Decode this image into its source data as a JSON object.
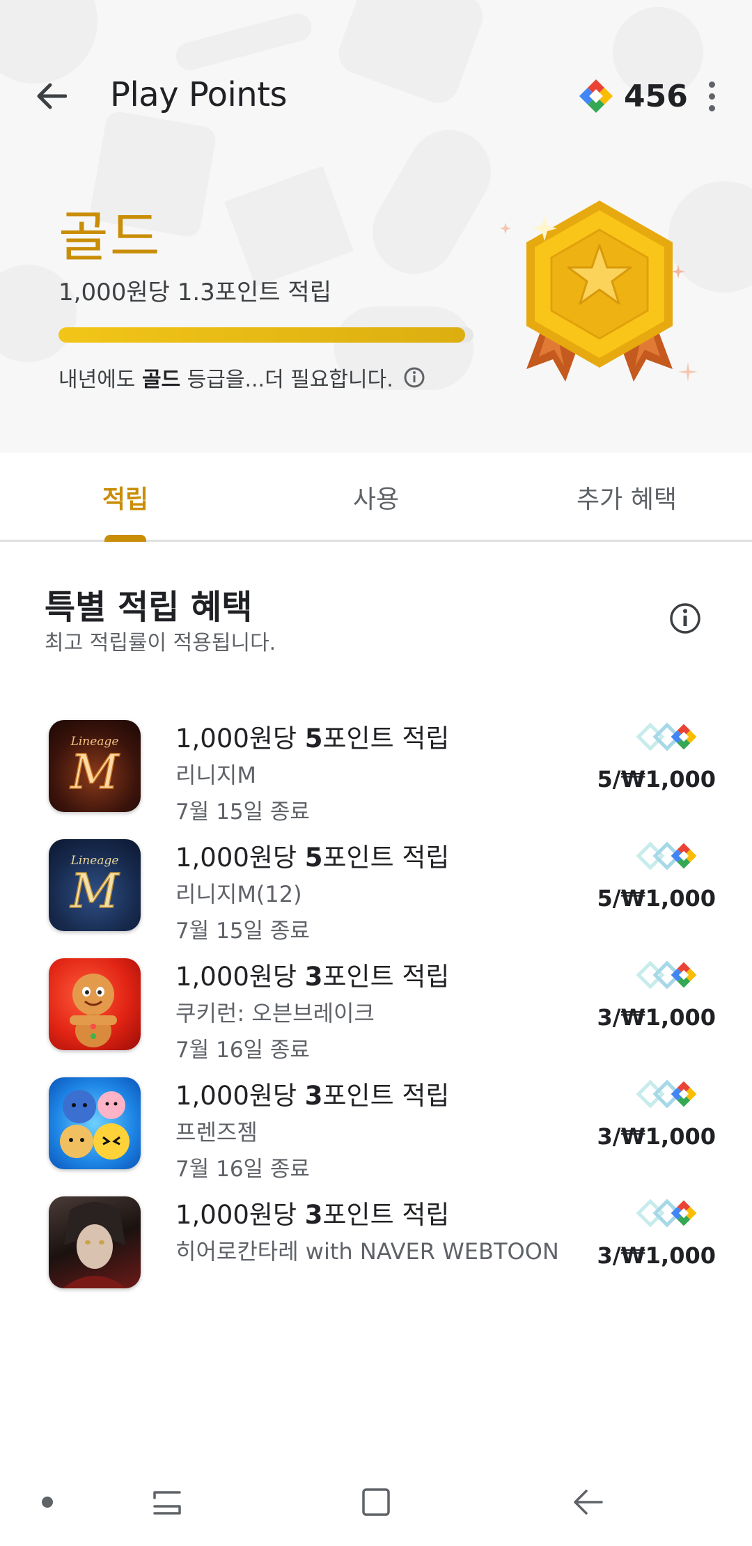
{
  "app_bar": {
    "title": "Play Points",
    "points": "456"
  },
  "tier": {
    "name": "골드",
    "rate_text": "1,000원당 1.3포인트 적립",
    "progress": 0.98,
    "note_prefix": "내년에도 ",
    "note_tier": "골드",
    "note_suffix": " 등급을...더 필요합니다."
  },
  "tabs": [
    {
      "label": "적립",
      "selected": true
    },
    {
      "label": "사용",
      "selected": false
    },
    {
      "label": "추가 혜택",
      "selected": false
    }
  ],
  "section": {
    "title": "특별 적립 혜택",
    "subtitle": "최고 적립률이 적용됩니다."
  },
  "offers": [
    {
      "title_prefix": "1,000원당 ",
      "title_bold": "5",
      "title_suffix": "포인트 적립",
      "app": "리니지M",
      "end": "7월 15일 종료",
      "rate": "5/₩1,000",
      "icon": "lineage-m-icon"
    },
    {
      "title_prefix": "1,000원당 ",
      "title_bold": "5",
      "title_suffix": "포인트 적립",
      "app": "리니지M(12)",
      "end": "7월 15일 종료",
      "rate": "5/₩1,000",
      "icon": "lineage-m-12-icon"
    },
    {
      "title_prefix": "1,000원당 ",
      "title_bold": "3",
      "title_suffix": "포인트 적립",
      "app": "쿠키런: 오븐브레이크",
      "end": "7월 16일 종료",
      "rate": "3/₩1,000",
      "icon": "cookie-run-icon"
    },
    {
      "title_prefix": "1,000원당 ",
      "title_bold": "3",
      "title_suffix": "포인트 적립",
      "app": "프렌즈젬",
      "end": "7월 16일 종료",
      "rate": "3/₩1,000",
      "icon": "friends-gem-icon"
    },
    {
      "title_prefix": "1,000원당 ",
      "title_bold": "3",
      "title_suffix": "포인트 적립",
      "app": "히어로칸타레 with NAVER WEBTOON",
      "end": "",
      "rate": "3/₩1,000",
      "icon": "hero-cantare-icon"
    }
  ],
  "colors": {
    "gold_accent": "#c98d06",
    "progress_fill": "#f2c519",
    "text_primary": "#202124",
    "text_secondary": "#5f6368"
  }
}
